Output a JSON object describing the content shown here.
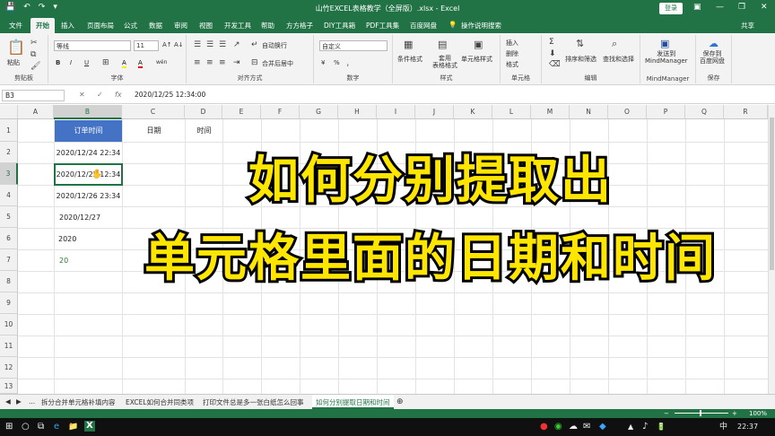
{
  "window": {
    "title": "山竹EXCEL表格教学（全屏版）.xlsx  -  Excel",
    "login_label": "登录",
    "minimize_icon": "—",
    "restore_icon": "❐",
    "close_icon": "✕",
    "ribbon_opt_icon": "▣"
  },
  "quick_access": {
    "save_icon": "💾",
    "undo_icon": "↶",
    "redo_icon": "↷",
    "more_icon": "▾"
  },
  "tabs": [
    "文件",
    "开始",
    "插入",
    "页面布局",
    "公式",
    "数据",
    "审阅",
    "视图",
    "开发工具",
    "帮助",
    "方方格子",
    "DIY工具箱",
    "PDF工具集",
    "百度网盘"
  ],
  "tell_me": "操作说明搜索",
  "share_label": "共享",
  "ribbon": {
    "clipboard": {
      "paste_label": "粘贴",
      "group_label": "剪贴板"
    },
    "font": {
      "font_name": "等线",
      "font_size": "11",
      "group_label": "字体",
      "bold": "B",
      "italic": "I",
      "underline": "U",
      "grow": "A↑",
      "shrink": "A↓",
      "fill_icon": "A",
      "wen": "wén"
    },
    "alignment": {
      "wrap_label": "自动换行",
      "merge_label": "合并后居中",
      "group_label": "对齐方式"
    },
    "number": {
      "format_value": "自定义",
      "group_label": "数字",
      "percent": "%",
      "comma": "，",
      "currency": "¥"
    },
    "styles": {
      "conditional_label": "条件格式",
      "table_label": "套用\n表格格式",
      "cell_style_label": "单元格样式",
      "group_label": "样式"
    },
    "cells": {
      "insert_label": "插入",
      "delete_label": "删除",
      "format_label": "格式",
      "group_label": "单元格"
    },
    "editing": {
      "sort_label": "排序和筛选",
      "find_label": "查找和选择",
      "group_label": "编辑",
      "sum_icon": "Σ"
    },
    "mindmanager": {
      "send_label": "发送到\nMindManager",
      "group_label": "MindManager"
    },
    "save": {
      "save_label": "保存到\n百度网盘",
      "group_label": "保存"
    }
  },
  "formula_bar": {
    "name_box": "B3",
    "cancel_icon": "✕",
    "enter_icon": "✓",
    "fx": "fx",
    "value": "2020/12/25  12:34:00"
  },
  "columns": [
    "A",
    "B",
    "C",
    "D",
    "E",
    "F",
    "G",
    "H",
    "I",
    "J",
    "K",
    "L",
    "M",
    "N",
    "O",
    "P",
    "Q",
    "R"
  ],
  "rows": [
    "1",
    "2",
    "3",
    "4",
    "5",
    "6",
    "7",
    "8",
    "9",
    "10",
    "11",
    "12",
    "13"
  ],
  "cells": {
    "b1": "订单时间",
    "c1": "日期",
    "d1": "时间",
    "b2": "2020/12/24 22:34",
    "b3": "2020/12/25 12:34",
    "b4": "2020/12/26 23:34",
    "b5": "2020/12/27",
    "b6": "2020",
    "b7": "20"
  },
  "overlay": {
    "line1": "如何分别提取出",
    "line2": "单元格里面的日期和时间"
  },
  "sheets": {
    "nav_more": "...",
    "tabs": [
      "拆分合并单元格补填内容",
      "EXCEL如何合并同类项",
      "打印文件总是多一张白纸怎么回事",
      "如何分别提取日期和时间"
    ],
    "add_icon": "⊕"
  },
  "status": {
    "zoom": "100%",
    "plus": "+",
    "minus": "−"
  },
  "taskbar": {
    "start_icon": "⊞",
    "search_icon": "○",
    "taskview_icon": "⧉",
    "ie_icon": "e",
    "folder_icon": "📁",
    "excel_icon": "X",
    "tray_icons": [
      "●",
      "◉",
      "☁",
      "✉",
      "◆",
      "▲",
      "♪",
      "🔋"
    ],
    "ime": "中",
    "time": "22:37"
  }
}
